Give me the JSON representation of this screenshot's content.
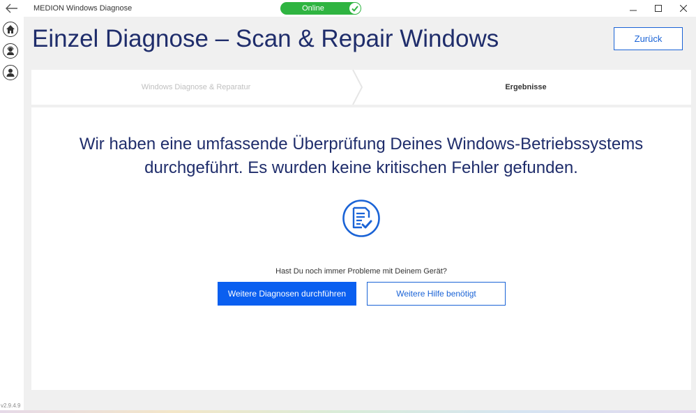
{
  "window": {
    "title": "MEDION Windows Diagnose",
    "status": "Online"
  },
  "sidebar": {
    "version": "v2.9.4.9"
  },
  "header": {
    "title": "Einzel Diagnose – Scan & Repair Windows",
    "back_label": "Zurück"
  },
  "steps": [
    {
      "label": "Windows Diagnose & Reparatur",
      "state": "done"
    },
    {
      "label": "Ergebnisse",
      "state": "active"
    }
  ],
  "result": {
    "message": "Wir haben eine umfassende Überprüfung Deines Windows-Betriebssystems durchgeführt. Es wurden keine kritischen Fehler gefunden.",
    "question": "Hast Du noch immer Probleme mit Deinem Gerät?",
    "primary_label": "Weitere Diagnosen durchführen",
    "secondary_label": "Weitere Hilfe benötigt"
  },
  "colors": {
    "accent": "#0a5ff0",
    "online": "#2fb441",
    "heading": "#1f2d6b"
  }
}
